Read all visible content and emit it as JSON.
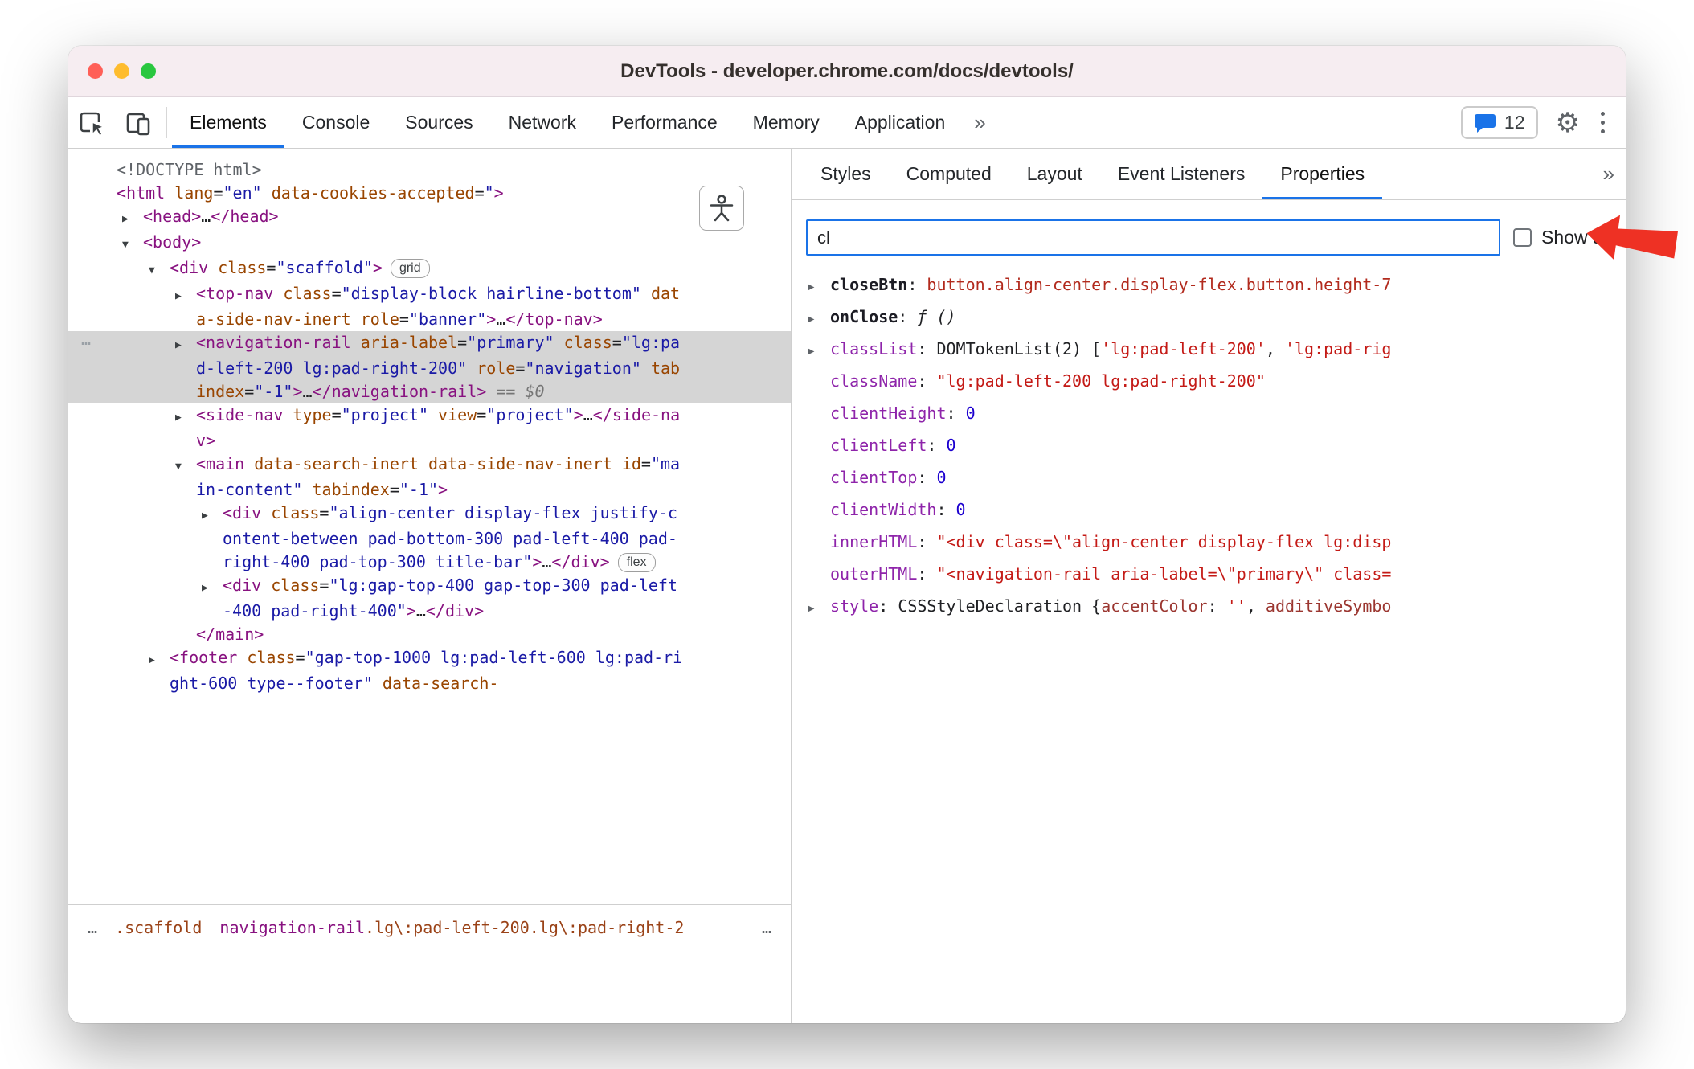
{
  "window": {
    "title": "DevTools - developer.chrome.com/docs/devtools/"
  },
  "toolbar": {
    "tabs": [
      "Elements",
      "Console",
      "Sources",
      "Network",
      "Performance",
      "Memory",
      "Application"
    ],
    "active_tab": "Elements",
    "more_label": "»",
    "issues_count": "12"
  },
  "sidebar": {
    "tabs": [
      "Styles",
      "Computed",
      "Layout",
      "Event Listeners",
      "Properties"
    ],
    "active_tab": "Properties",
    "more_label": "»",
    "filter": {
      "value": "cl",
      "show_all_label": "Show all",
      "show_all_checked": false
    },
    "properties": [
      {
        "name": "closeBtn",
        "bold": true,
        "arrow": true,
        "value": [
          {
            "t": "node",
            "x": "button.align-center.display-flex.button.height-7"
          }
        ]
      },
      {
        "name": "onClose",
        "bold": true,
        "arrow": true,
        "value": [
          {
            "t": "fn",
            "x": "ƒ ()"
          }
        ]
      },
      {
        "name": "classList",
        "bold": false,
        "arrow": true,
        "value": [
          {
            "t": "plain",
            "x": "DOMTokenList(2) ["
          },
          {
            "t": "str",
            "x": "'lg:pad-left-200'"
          },
          {
            "t": "plain",
            "x": ", "
          },
          {
            "t": "str",
            "x": "'lg:pad-rig"
          }
        ]
      },
      {
        "name": "className",
        "bold": false,
        "arrow": false,
        "value": [
          {
            "t": "str",
            "x": "\"lg:pad-left-200 lg:pad-right-200\""
          }
        ]
      },
      {
        "name": "clientHeight",
        "bold": false,
        "arrow": false,
        "value": [
          {
            "t": "num",
            "x": "0"
          }
        ]
      },
      {
        "name": "clientLeft",
        "bold": false,
        "arrow": false,
        "value": [
          {
            "t": "num",
            "x": "0"
          }
        ]
      },
      {
        "name": "clientTop",
        "bold": false,
        "arrow": false,
        "value": [
          {
            "t": "num",
            "x": "0"
          }
        ]
      },
      {
        "name": "clientWidth",
        "bold": false,
        "arrow": false,
        "value": [
          {
            "t": "num",
            "x": "0"
          }
        ]
      },
      {
        "name": "innerHTML",
        "bold": false,
        "arrow": false,
        "value": [
          {
            "t": "str",
            "x": "\"<div class=\\\"align-center display-flex lg:disp"
          }
        ]
      },
      {
        "name": "outerHTML",
        "bold": false,
        "arrow": false,
        "value": [
          {
            "t": "str",
            "x": "\"<navigation-rail aria-label=\\\"primary\\\" class="
          }
        ]
      },
      {
        "name": "style",
        "bold": false,
        "arrow": true,
        "value": [
          {
            "t": "plain",
            "x": "CSSStyleDeclaration {"
          },
          {
            "t": "key",
            "x": "accentColor"
          },
          {
            "t": "plain",
            "x": ": "
          },
          {
            "t": "str",
            "x": "''"
          },
          {
            "t": "plain",
            "x": ", "
          },
          {
            "t": "key",
            "x": "additiveSymbo"
          }
        ]
      }
    ]
  },
  "tree": {
    "nodes": [
      {
        "indent": 0,
        "arrow": null,
        "selected": false,
        "segs": [
          {
            "t": "doctype",
            "x": "<!DOCTYPE html>"
          }
        ]
      },
      {
        "indent": 0,
        "arrow": null,
        "selected": false,
        "segs": [
          {
            "t": "tag",
            "x": "<html"
          },
          {
            "t": "attr",
            "x": " lang"
          },
          {
            "t": "plain",
            "x": "="
          },
          {
            "t": "val",
            "x": "\"en\""
          },
          {
            "t": "attr",
            "x": " data-cookies-accepted"
          },
          {
            "t": "plain",
            "x": "="
          },
          {
            "t": "val",
            "x": "\""
          },
          {
            "t": "tag",
            "x": ">"
          }
        ]
      },
      {
        "indent": 1,
        "arrow": "right",
        "selected": false,
        "segs": [
          {
            "t": "tag",
            "x": "<head>"
          },
          {
            "t": "plain",
            "x": "…"
          },
          {
            "t": "tag",
            "x": "</head>"
          }
        ]
      },
      {
        "indent": 1,
        "arrow": "down",
        "selected": false,
        "segs": [
          {
            "t": "tag",
            "x": "<body>"
          }
        ]
      },
      {
        "indent": 2,
        "arrow": "down",
        "selected": false,
        "segs": [
          {
            "t": "tag",
            "x": "<div"
          },
          {
            "t": "attr",
            "x": " class"
          },
          {
            "t": "plain",
            "x": "="
          },
          {
            "t": "val",
            "x": "\"scaffold\""
          },
          {
            "t": "tag",
            "x": ">"
          },
          {
            "t": "badge",
            "x": "grid"
          }
        ]
      },
      {
        "indent": 3,
        "arrow": "right",
        "selected": false,
        "segs": [
          {
            "t": "tag",
            "x": "<top-nav"
          },
          {
            "t": "attr",
            "x": " class"
          },
          {
            "t": "plain",
            "x": "="
          },
          {
            "t": "val",
            "x": "\"display-block hairline-bottom\""
          },
          {
            "t": "attr",
            "x": " data-side-nav-inert"
          },
          {
            "t": "attr",
            "x": " role"
          },
          {
            "t": "plain",
            "x": "="
          },
          {
            "t": "val",
            "x": "\"banner\""
          },
          {
            "t": "tag",
            "x": ">"
          },
          {
            "t": "plain",
            "x": "…"
          },
          {
            "t": "tag",
            "x": "</top-nav>"
          }
        ]
      },
      {
        "indent": 3,
        "arrow": "right",
        "selected": true,
        "gutter_dots": true,
        "segs": [
          {
            "t": "tag",
            "x": "<navigation-rail"
          },
          {
            "t": "attr",
            "x": " aria-label"
          },
          {
            "t": "plain",
            "x": "="
          },
          {
            "t": "val",
            "x": "\"primary\""
          },
          {
            "t": "attr",
            "x": " class"
          },
          {
            "t": "plain",
            "x": "="
          },
          {
            "t": "val",
            "x": "\"lg:pad-left-200 lg:pad-right-200\""
          },
          {
            "t": "attr",
            "x": " role"
          },
          {
            "t": "plain",
            "x": "="
          },
          {
            "t": "val",
            "x": "\"navigation\""
          },
          {
            "t": "attr",
            "x": " tabindex"
          },
          {
            "t": "plain",
            "x": "="
          },
          {
            "t": "val",
            "x": "\"-1\""
          },
          {
            "t": "tag",
            "x": ">"
          },
          {
            "t": "plain",
            "x": "…"
          },
          {
            "t": "tag",
            "x": "</navigation-rail>"
          },
          {
            "t": "eq",
            "x": " == $0"
          }
        ]
      },
      {
        "indent": 3,
        "arrow": "right",
        "selected": false,
        "segs": [
          {
            "t": "tag",
            "x": "<side-nav"
          },
          {
            "t": "attr",
            "x": " type"
          },
          {
            "t": "plain",
            "x": "="
          },
          {
            "t": "val",
            "x": "\"project\""
          },
          {
            "t": "attr",
            "x": " view"
          },
          {
            "t": "plain",
            "x": "="
          },
          {
            "t": "val",
            "x": "\"project\""
          },
          {
            "t": "tag",
            "x": ">"
          },
          {
            "t": "plain",
            "x": "…"
          },
          {
            "t": "tag",
            "x": "</side-nav>"
          }
        ]
      },
      {
        "indent": 3,
        "arrow": "down",
        "selected": false,
        "segs": [
          {
            "t": "tag",
            "x": "<main"
          },
          {
            "t": "attr",
            "x": " data-search-inert"
          },
          {
            "t": "attr",
            "x": " data-side-nav-inert"
          },
          {
            "t": "attr",
            "x": " id"
          },
          {
            "t": "plain",
            "x": "="
          },
          {
            "t": "val",
            "x": "\"main-content\""
          },
          {
            "t": "attr",
            "x": " tabindex"
          },
          {
            "t": "plain",
            "x": "="
          },
          {
            "t": "val",
            "x": "\"-1\""
          },
          {
            "t": "tag",
            "x": ">"
          }
        ]
      },
      {
        "indent": 4,
        "arrow": "right",
        "selected": false,
        "segs": [
          {
            "t": "tag",
            "x": "<div"
          },
          {
            "t": "attr",
            "x": " class"
          },
          {
            "t": "plain",
            "x": "="
          },
          {
            "t": "val",
            "x": "\"align-center display-flex justify-content-between pad-bottom-300 pad-left-400 pad-right-400 pad-top-300 title-bar\""
          },
          {
            "t": "tag",
            "x": ">"
          },
          {
            "t": "plain",
            "x": "…"
          },
          {
            "t": "tag",
            "x": "</div>"
          },
          {
            "t": "badge",
            "x": "flex"
          }
        ]
      },
      {
        "indent": 4,
        "arrow": "right",
        "selected": false,
        "segs": [
          {
            "t": "tag",
            "x": "<div"
          },
          {
            "t": "attr",
            "x": " class"
          },
          {
            "t": "plain",
            "x": "="
          },
          {
            "t": "val",
            "x": "\"lg:gap-top-400 gap-top-300 pad-left-400 pad-right-400\""
          },
          {
            "t": "tag",
            "x": ">"
          },
          {
            "t": "plain",
            "x": "…"
          },
          {
            "t": "tag",
            "x": "</div>"
          }
        ]
      },
      {
        "indent": 3,
        "arrow": null,
        "selected": false,
        "segs": [
          {
            "t": "tag",
            "x": "</main>"
          }
        ]
      },
      {
        "indent": 2,
        "arrow": "right",
        "selected": false,
        "segs": [
          {
            "t": "tag",
            "x": "<footer"
          },
          {
            "t": "attr",
            "x": " class"
          },
          {
            "t": "plain",
            "x": "="
          },
          {
            "t": "val",
            "x": "\"gap-top-1000 lg:pad-left-600 lg:pad-right-600 type--footer\""
          },
          {
            "t": "attr",
            "x": " data-search-"
          }
        ]
      }
    ]
  },
  "breadcrumbs": {
    "items": [
      {
        "name": "crumb-ellipsis",
        "overflow": false,
        "segs": [
          {
            "t": "dim",
            "x": "…"
          }
        ]
      },
      {
        "name": "crumb-scaffold",
        "overflow": false,
        "segs": [
          {
            "t": "ccls",
            "x": ".scaffold"
          }
        ]
      },
      {
        "name": "crumb-navigation-rail",
        "overflow": false,
        "segs": [
          {
            "t": "ctag",
            "x": "navigation-rail"
          },
          {
            "t": "ccls",
            "x": ".lg\\:pad-left-200.lg\\:pad-right-2"
          }
        ]
      },
      {
        "name": "crumb-overflow",
        "overflow": true,
        "segs": [
          {
            "t": "dim",
            "x": "…"
          }
        ]
      }
    ]
  },
  "icons": {
    "inspect": "cursor-in-box",
    "device_toolbar": "phone-and-tablet",
    "issues": "chat-bubble",
    "settings": "gear",
    "menu": "kebab-dots",
    "accessibility": "person",
    "annotation": "left-red-arrow"
  },
  "colors": {
    "accent": "#1a73e8",
    "annotation_red": "#ee3124",
    "selection": "#d5d5d5",
    "tag": "#881280",
    "attribute": "#994500",
    "attr_value": "#1a1aa6",
    "string": "#c41a16",
    "number": "#1c00cf"
  }
}
